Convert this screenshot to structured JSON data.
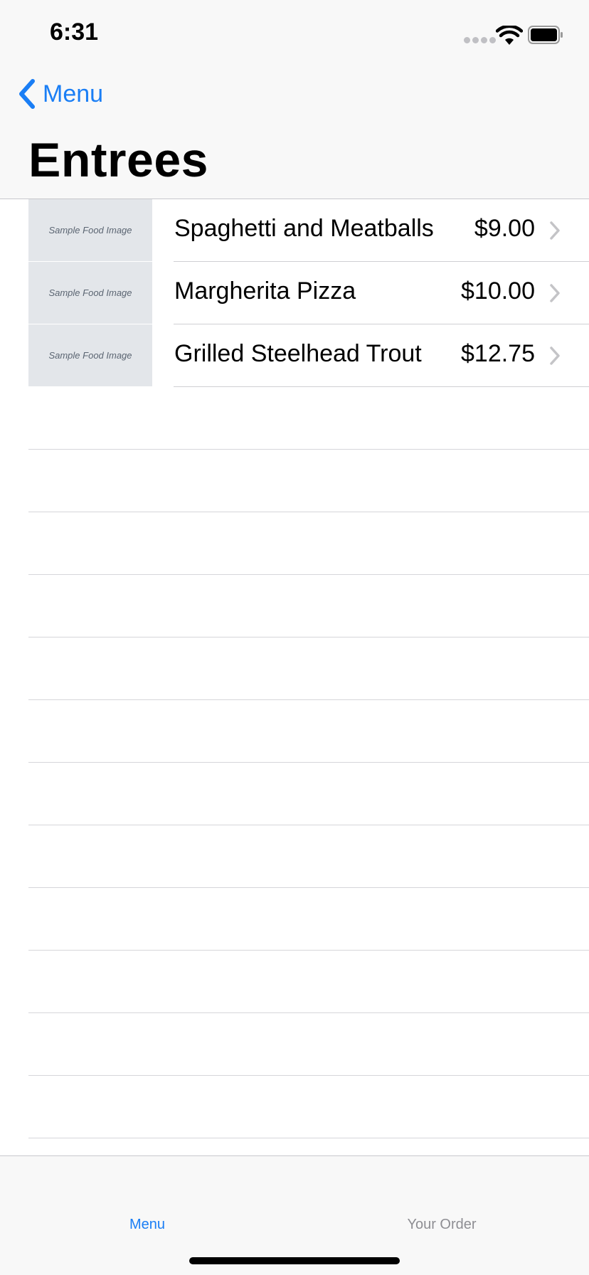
{
  "status_bar": {
    "time": "6:31"
  },
  "nav": {
    "back_label": "Menu",
    "title": "Entrees"
  },
  "items": [
    {
      "image_label": "Sample Food Image",
      "name": "Spaghetti and Meatballs",
      "price": "$9.00"
    },
    {
      "image_label": "Sample Food Image",
      "name": "Margherita Pizza",
      "price": "$10.00"
    },
    {
      "image_label": "Sample Food Image",
      "name": "Grilled Steelhead Trout",
      "price": "$12.75"
    }
  ],
  "tab_bar": {
    "tabs": [
      {
        "label": "Menu",
        "selected": true
      },
      {
        "label": "Your Order",
        "selected": false
      }
    ]
  },
  "colors": {
    "accent": "#1a7ef5",
    "inactive_tab": "#8e8e93",
    "thumbnail_bg": "#e3e6ea"
  },
  "icons": [
    "wifi-icon",
    "battery-icon",
    "signal-icon",
    "chevron-left-icon",
    "chevron-right-icon"
  ]
}
